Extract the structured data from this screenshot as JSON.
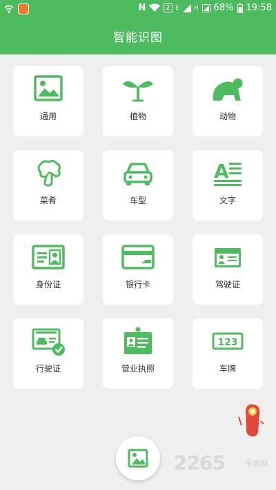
{
  "status_bar": {
    "nfc_letter": "N",
    "sim_badge": "2",
    "signal_e": "E",
    "signal_h": "H",
    "battery_percent": "68%",
    "time": "19:58"
  },
  "header": {
    "title": "智能识图"
  },
  "categories": [
    {
      "label": "通用",
      "icon": "picture-icon"
    },
    {
      "label": "植物",
      "icon": "sprout-icon"
    },
    {
      "label": "动物",
      "icon": "animal-icon"
    },
    {
      "label": "菜肴",
      "icon": "broccoli-icon"
    },
    {
      "label": "车型",
      "icon": "car-icon"
    },
    {
      "label": "文字",
      "icon": "text-icon"
    },
    {
      "label": "身份证",
      "icon": "id-card-icon"
    },
    {
      "label": "银行卡",
      "icon": "bank-card-icon"
    },
    {
      "label": "驾驶证",
      "icon": "driver-license-icon"
    },
    {
      "label": "行驶证",
      "icon": "vehicle-license-icon"
    },
    {
      "label": "营业执照",
      "icon": "business-license-icon"
    },
    {
      "label": "车牌",
      "icon": "license-plate-icon"
    }
  ],
  "license_plate_text": "123",
  "text_icon_letter": "A",
  "fab": {
    "icon": "gallery-icon"
  },
  "watermark": {
    "brand": "2265",
    "suffix": "手游网"
  },
  "colors": {
    "accent": "#4cbc5f",
    "background": "#efefef",
    "card": "#ffffff"
  }
}
